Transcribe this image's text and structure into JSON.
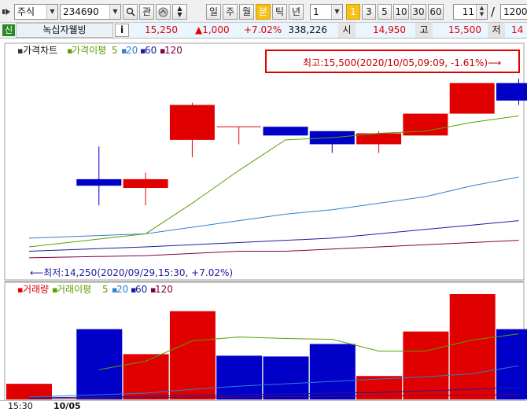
{
  "toolbar": {
    "market_select": "주식",
    "code_value": "234690",
    "search_icon": "search-icon",
    "related_label": "관",
    "period_buttons": [
      "일",
      "주",
      "월",
      "분",
      "틱",
      "년"
    ],
    "active_period": "분",
    "interval_value": "1",
    "interval_presets": [
      "1",
      "3",
      "5",
      "10",
      "30",
      "60"
    ],
    "active_preset": "1",
    "count_value": "11",
    "slash": "/",
    "total_value": "1200"
  },
  "quote_bar": {
    "badge": "신",
    "stock_name": "녹십자웰빙",
    "info_label": "i",
    "price": "15,250",
    "change": "▲1,000",
    "change_pct": "+7.02%",
    "volume": "338,226",
    "open_label": "시",
    "open_value": "14,950",
    "high_label": "고",
    "high_value": "15,500",
    "low_label": "저",
    "low_value": "14"
  },
  "price_panel": {
    "legend": {
      "name": "가격차트",
      "ma_name": "가격이평",
      "ma_periods": [
        "5",
        "20",
        "60",
        "120"
      ]
    },
    "high_annotation": "최고:15,500(2020/10/05,09:09, -1.61%)⟶",
    "low_annotation": "⟵최저:14,250(2020/09/29,15:30, +7.02%)"
  },
  "volume_panel": {
    "legend": {
      "name": "거래량",
      "ma_name": "거래이평",
      "ma_periods": [
        "5",
        "20",
        "60",
        "120"
      ]
    }
  },
  "x_axis": {
    "labels": [
      "15:30",
      "10/05"
    ]
  },
  "colors": {
    "up": "#e00000",
    "down": "#0000c8",
    "ma5": "#5aa000",
    "ma20": "#2f80d0",
    "ma60": "#1c1ca0",
    "ma120": "#800040",
    "annotation_box": "#e00000"
  },
  "chart_data": {
    "type": "candlestick",
    "candles": [
      {
        "open": 14650,
        "high": 14800,
        "low": 14530,
        "close": 14620,
        "dir": "down"
      },
      {
        "open": 14610,
        "high": 14680,
        "low": 14530,
        "close": 14650,
        "dir": "up"
      },
      {
        "open": 14830,
        "high": 15000,
        "low": 14750,
        "close": 14990,
        "dir": "up"
      },
      {
        "open": 14890,
        "high": 14890,
        "low": 14810,
        "close": 14890,
        "dir": "flat"
      },
      {
        "open": 14890,
        "high": 14890,
        "low": 14890,
        "close": 14850,
        "dir": "down"
      },
      {
        "open": 14870,
        "high": 14870,
        "low": 14770,
        "close": 14810,
        "dir": "down"
      },
      {
        "open": 14810,
        "high": 14870,
        "low": 14770,
        "close": 14860,
        "dir": "up"
      },
      {
        "open": 14850,
        "high": 14950,
        "low": 14850,
        "close": 14950,
        "dir": "up"
      },
      {
        "open": 14950,
        "high": 15090,
        "low": 14950,
        "close": 15090,
        "dir": "up"
      },
      {
        "open": 15090,
        "high": 15110,
        "low": 14990,
        "close": 15010,
        "dir": "down"
      }
    ],
    "ma5": [
      14340,
      14400,
      14540,
      14690,
      14830,
      14840,
      14860,
      14870,
      14910,
      14940
    ],
    "ma20": [
      14380,
      14400,
      14430,
      14460,
      14490,
      14510,
      14540,
      14570,
      14620,
      14660
    ],
    "ma60": [
      14320,
      14340,
      14350,
      14360,
      14370,
      14380,
      14400,
      14420,
      14440,
      14460
    ],
    "ma120": [
      14290,
      14300,
      14310,
      14320,
      14320,
      14330,
      14340,
      14350,
      14360,
      14370
    ],
    "price_range": [
      14250,
      15150
    ],
    "volumes": [
      20000,
      90000,
      58000,
      113000,
      56000,
      55000,
      71000,
      30000,
      87000,
      135000,
      90000
    ],
    "vol_ma5": [
      null,
      38000,
      49000,
      75000,
      80000,
      78000,
      77000,
      62000,
      62000,
      76000,
      84000
    ],
    "vol_ma20": [
      3000,
      6000,
      8000,
      13000,
      17000,
      20000,
      23000,
      26000,
      29000,
      33000,
      43000
    ],
    "vol_ma60": [
      2000,
      3000,
      4000,
      5000,
      6000,
      7000,
      8000,
      9000,
      11000,
      13000,
      15000
    ],
    "vol_ma120": [
      1000,
      1500,
      2000,
      2500,
      3000,
      3500,
      4000,
      4500,
      5000,
      5500,
      6000
    ],
    "volume_range": [
      0,
      140000
    ]
  }
}
